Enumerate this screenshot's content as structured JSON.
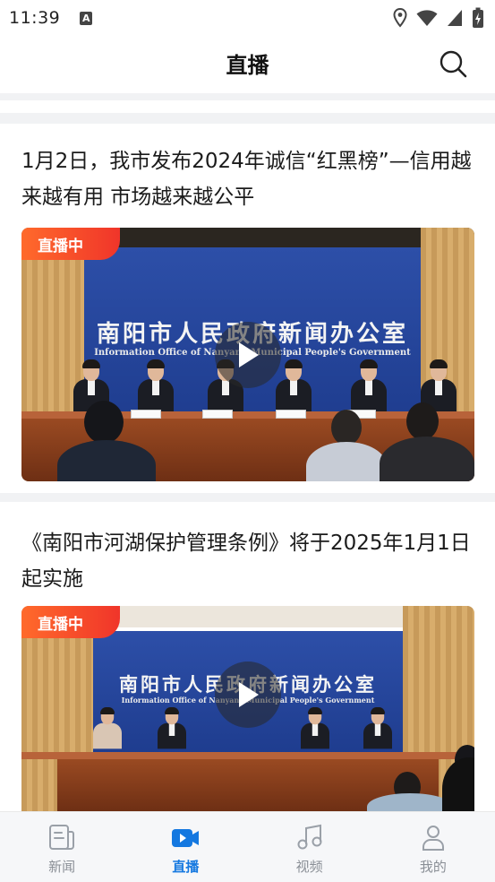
{
  "status_bar": {
    "time": "11:39",
    "app_icon_letter": "A"
  },
  "header": {
    "title": "直播",
    "search_icon": "search-icon"
  },
  "cards": [
    {
      "title": "1月2日，我市发布2024年诚信“红黑榜”—信用越来越有用 市场越来越公平",
      "badge": "直播中",
      "backdrop_cn": "南阳市人民政府新闻办公室",
      "backdrop_en": "Information Office of Nanyang Municipal People's Government"
    },
    {
      "title": "《南阳市河湖保护管理条例》将于2025年1月1日起实施",
      "badge": "直播中",
      "backdrop_cn": "南阳市人民政府新闻办公室",
      "backdrop_en": "Information Office of Nanyang Municipal People's Government"
    }
  ],
  "bottom_nav": [
    {
      "label": "新闻",
      "icon": "news-icon",
      "active": false
    },
    {
      "label": "直播",
      "icon": "live-video-icon",
      "active": true
    },
    {
      "label": "视频",
      "icon": "music-note-icon",
      "active": false
    },
    {
      "label": "我的",
      "icon": "user-icon",
      "active": false
    }
  ],
  "colors": {
    "accent": "#1478e0",
    "badge": "#f0352a",
    "backdrop": "#2d4fa8"
  }
}
